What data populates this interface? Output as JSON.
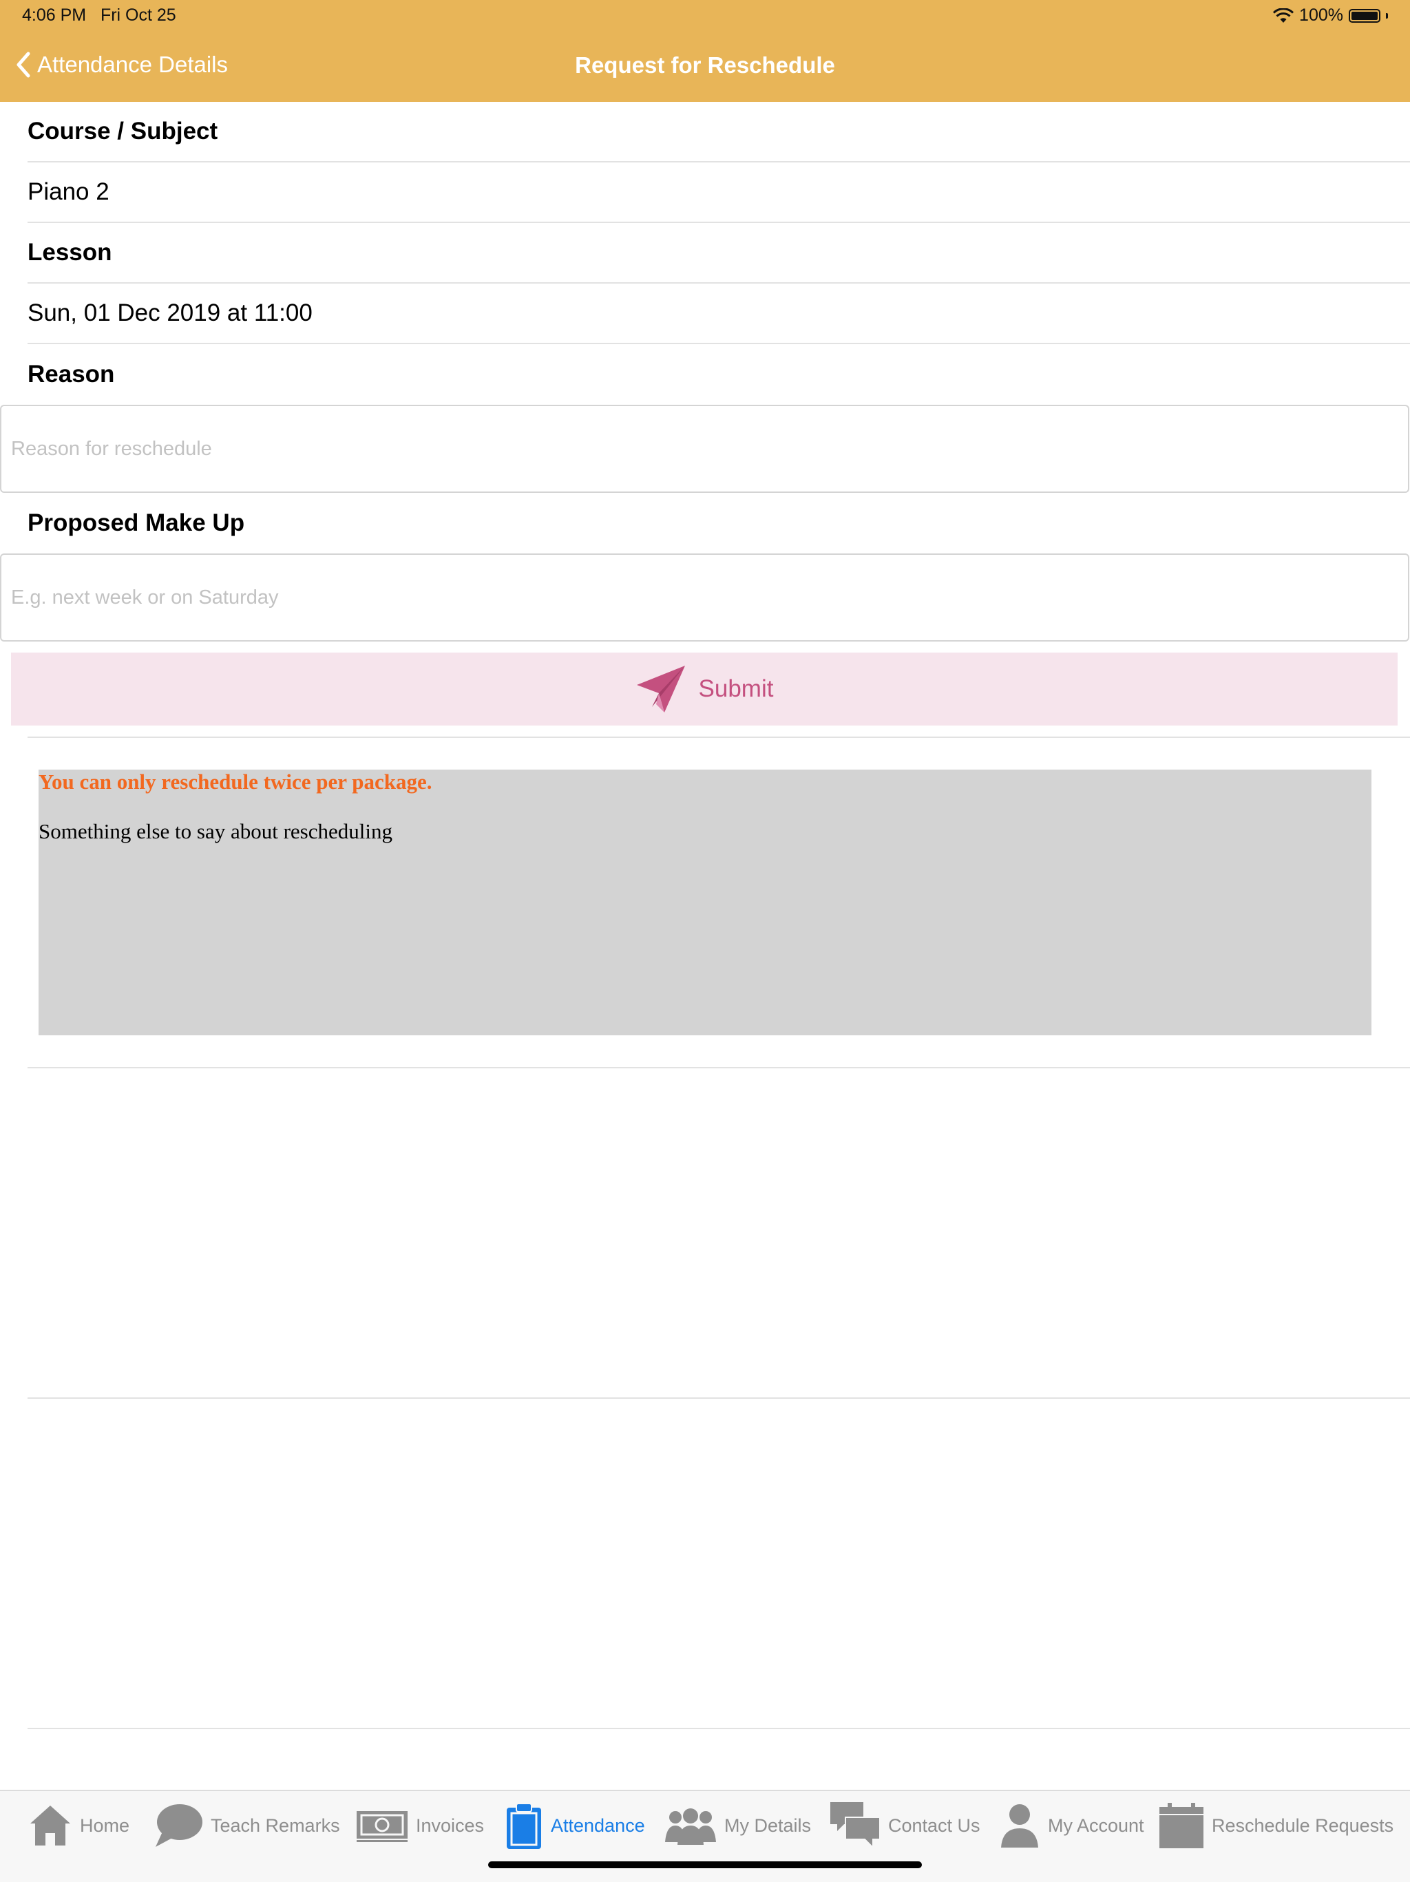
{
  "status_bar": {
    "time": "4:06 PM",
    "date": "Fri Oct 25",
    "battery": "100%"
  },
  "nav": {
    "back_label": "Attendance Details",
    "title": "Request for Reschedule"
  },
  "form": {
    "course_label": "Course / Subject",
    "course_value": "Piano 2",
    "lesson_label": "Lesson",
    "lesson_value": "Sun, 01 Dec 2019 at 11:00",
    "reason_label": "Reason",
    "reason_value": "",
    "reason_placeholder": "Reason for reschedule",
    "makeup_label": "Proposed Make Up",
    "makeup_value": "",
    "makeup_placeholder": "E.g. next week or on Saturday",
    "submit_label": "Submit"
  },
  "notice": {
    "warning": "You can only reschedule twice per package.",
    "text": "Something else to say about rescheduling"
  },
  "tabs": [
    {
      "label": "Home",
      "icon": "home-icon"
    },
    {
      "label": "Teach Remarks",
      "icon": "speech-bubble-icon"
    },
    {
      "label": "Invoices",
      "icon": "banknote-icon"
    },
    {
      "label": "Attendance",
      "icon": "clipboard-icon",
      "active": true
    },
    {
      "label": "My Details",
      "icon": "group-icon"
    },
    {
      "label": "Contact Us",
      "icon": "chat-bubbles-icon"
    },
    {
      "label": "My Account",
      "icon": "person-icon"
    },
    {
      "label": "Reschedule Requests",
      "icon": "calendar-icon"
    }
  ],
  "colors": {
    "header": "#e8b558",
    "accent": "#1a7ee6",
    "submit_bg": "#f6e4ec",
    "submit_fg": "#c4507f",
    "warning": "#f2681f"
  }
}
